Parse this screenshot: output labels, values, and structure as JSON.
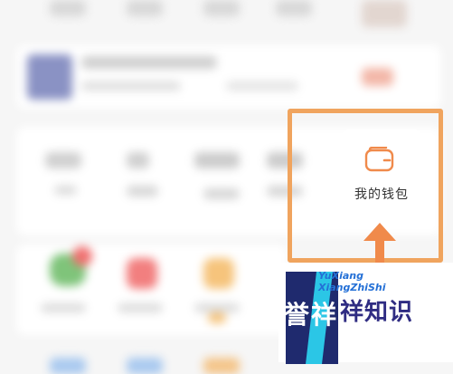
{
  "highlight": {
    "label": "我的钱包",
    "icon": "wallet-icon",
    "border_color": "#f0a45e"
  },
  "watermark": {
    "en_line1": "YuXiang",
    "en_line2": "XiangZhiShi",
    "badge_char1": "誉",
    "badge_char2": "祥",
    "cn_text": "祥知识"
  },
  "colors": {
    "accent_orange": "#f08a4b",
    "logo_navy": "#1f2a6e",
    "logo_cyan": "#2bc6e6"
  }
}
